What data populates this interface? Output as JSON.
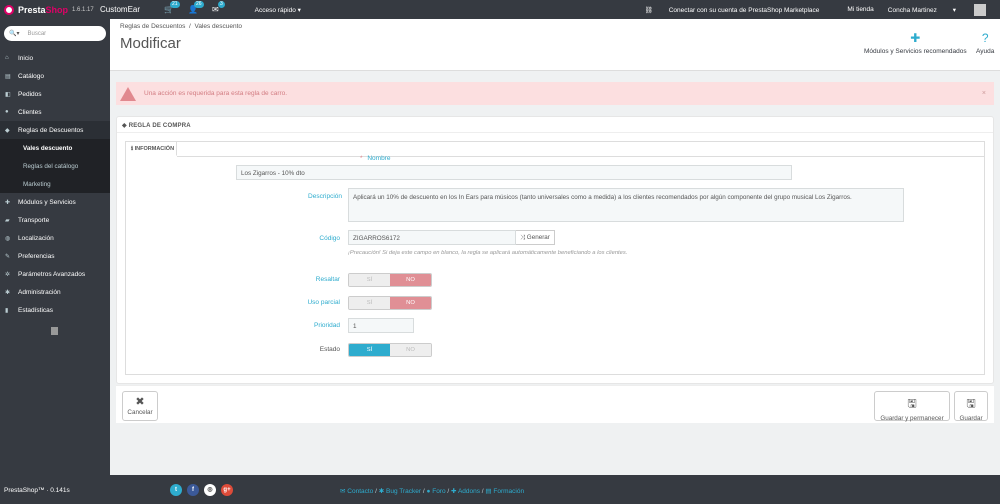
{
  "topbar": {
    "logo_brand_1": "Presta",
    "logo_brand_2": "Shop",
    "version": "1.6.1.17",
    "shop_name": "CustomEar",
    "notif_orders": "21",
    "notif_customers": "26",
    "notif_messages": "3",
    "quick_access": "Acceso rápido",
    "marketplace": "Conectar con su cuenta de PrestaShop Marketplace",
    "my_shop": "Mi tienda",
    "user": "Concha Martinez"
  },
  "sidebar": {
    "search_placeholder": "Buscar",
    "items": [
      {
        "label": "Inicio",
        "icon": "home-icon"
      },
      {
        "label": "Catálogo",
        "icon": "catalog-icon"
      },
      {
        "label": "Pedidos",
        "icon": "cart-icon"
      },
      {
        "label": "Clientes",
        "icon": "users-icon"
      },
      {
        "label": "Reglas de Descuentos",
        "icon": "tag-icon"
      },
      {
        "label": "Vales descuento"
      },
      {
        "label": "Reglas del catálogo"
      },
      {
        "label": "Marketing"
      },
      {
        "label": "Módulos y Servicios",
        "icon": "puzzle-icon"
      },
      {
        "label": "Transporte",
        "icon": "truck-icon"
      },
      {
        "label": "Localización",
        "icon": "globe-icon"
      },
      {
        "label": "Preferencias",
        "icon": "wrench-icon"
      },
      {
        "label": "Parámetros Avanzados",
        "icon": "cogs-icon"
      },
      {
        "label": "Administración",
        "icon": "cog-icon"
      },
      {
        "label": "Estadísticas",
        "icon": "bar-chart-icon"
      }
    ]
  },
  "header": {
    "breadcrumb_1": "Reglas de Descuentos",
    "breadcrumb_sep": "/",
    "breadcrumb_2": "Vales descuento",
    "title": "Modificar",
    "modules_label": "Módulos y Servicios recomendados",
    "help_label": "Ayuda"
  },
  "alert": {
    "message": "Una acción es requerida para esta regla de carro."
  },
  "panel": {
    "heading": "REGLA DE COMPRA",
    "tab": "INFORMACIÓN",
    "name_label": "Nombre",
    "name_value": "Los Zigarros - 10% dto",
    "description_label": "Descripción",
    "description_value": "Aplicará un 10% de descuento en los In Ears para músicos (tanto universales como a medida) a los clientes recomendados por algún componente del grupo musical Los Zigarros.",
    "code_label": "Código",
    "code_value": "ZIGARROS6172",
    "generate_label": "Generar",
    "code_hint": "¡Precaución! Si deja este campo en blanco, la regla se aplicará automáticamente beneficiando a los clientes.",
    "highlight_label": "Resaltar",
    "partial_label": "Uso parcial",
    "priority_label": "Prioridad",
    "priority_value": "1",
    "status_label": "Estado",
    "yes": "SÍ",
    "no": "NO"
  },
  "footer_buttons": {
    "cancel": "Cancelar",
    "save_stay": "Guardar y permanecer",
    "save": "Guardar"
  },
  "bottombar": {
    "version": "PrestaShop™ · 0.141s",
    "links": [
      "Contacto",
      "Bug Tracker",
      "Foro",
      "Addons",
      "Formación"
    ],
    "sep": "/"
  },
  "colors": {
    "accent": "#2eacce",
    "danger": "#e08f95",
    "dark": "#363a41"
  }
}
